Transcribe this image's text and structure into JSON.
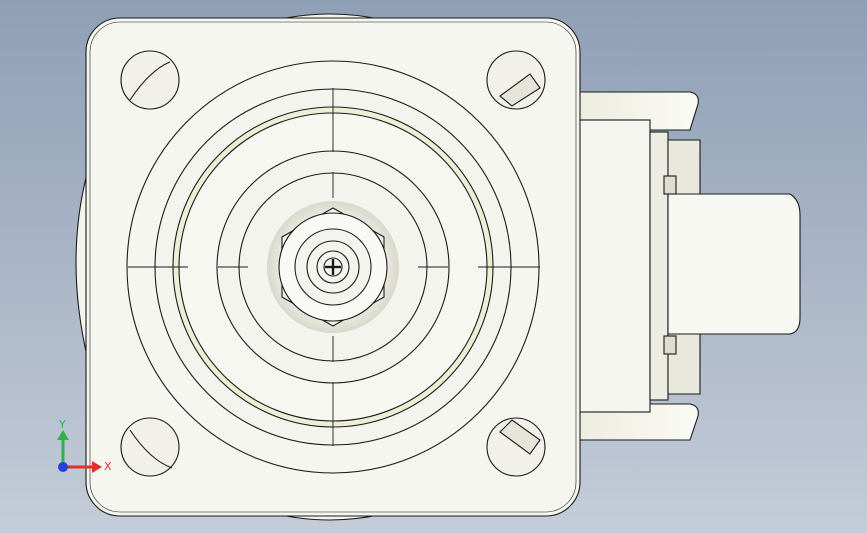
{
  "viewport": {
    "background_top": "#8f9fb6",
    "background_bottom": "#c4ccd8"
  },
  "model": {
    "fill_color": "#f4f4ee",
    "shade_color": "#deded2",
    "edge_color": "#1a1a1a"
  },
  "triad": {
    "x_label": "X",
    "y_label": "Y",
    "x_color": "#e0302a",
    "y_color": "#2fb24a",
    "z_color": "#2a3fd8"
  }
}
